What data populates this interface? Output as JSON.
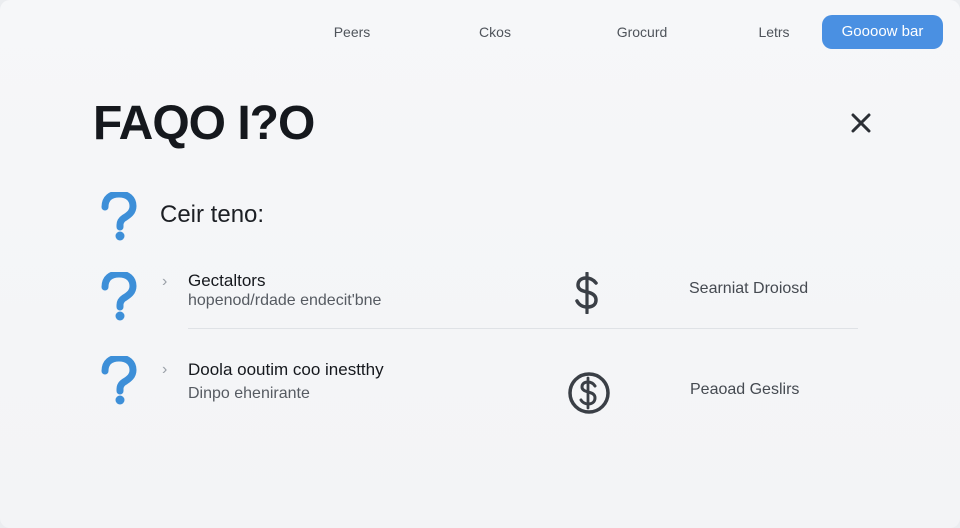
{
  "nav": {
    "links": [
      "Peers",
      "Ckos",
      "Grocurd",
      "Letrs"
    ],
    "cta_label": "Goooow bar"
  },
  "faq": {
    "title": "FAQO I?O",
    "intro": "Ceir teno:",
    "items": [
      {
        "question": "Gectaltors",
        "answer": "hopenod/rdade endecit'bne",
        "side_icon": "dollar-icon",
        "side_label": "Searniat Droiosd"
      },
      {
        "question": "Doola ooutim coo inestthy",
        "answer": "Dinpo ehenirante",
        "side_icon": "dollar-circle-icon",
        "side_label": "Peaoad Geslirs"
      }
    ]
  },
  "colors": {
    "accent": "#4a90e2",
    "question_icon": "#3d8fd8",
    "background": "#f4f5f7"
  }
}
